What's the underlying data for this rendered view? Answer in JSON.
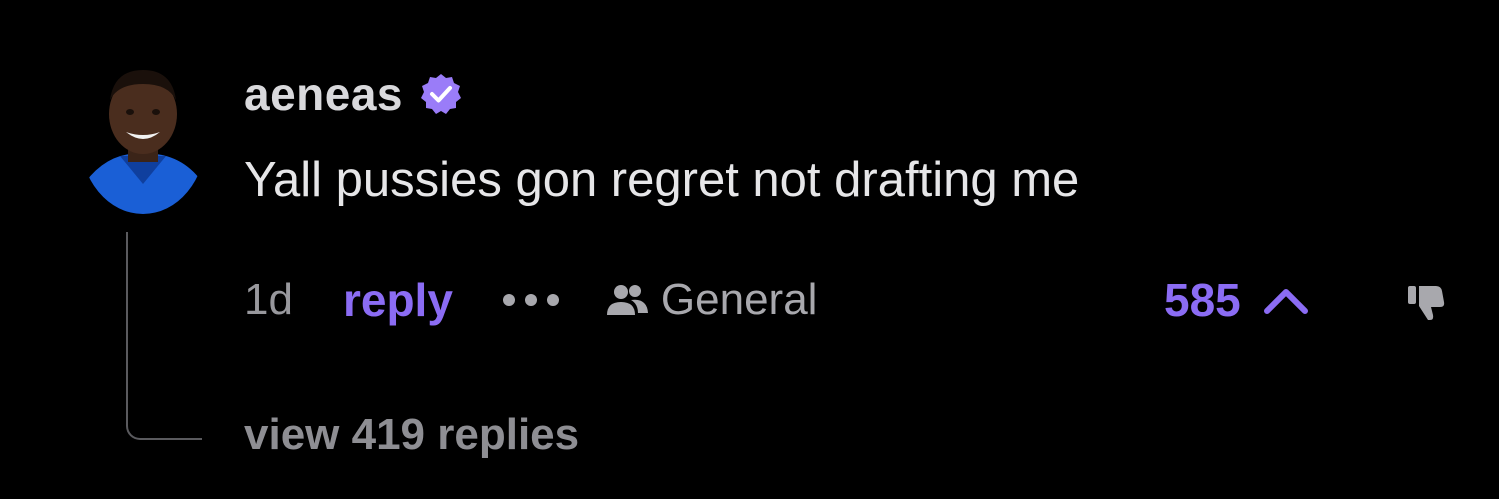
{
  "comment": {
    "username": "aeneas",
    "verified_icon": "verified-check-icon",
    "text": "Yall pussies gon regret not drafting me",
    "time_ago": "1d",
    "reply_label": "reply",
    "more_icon": "more-dots-icon",
    "channel_icon": "group-icon",
    "channel_label": "General",
    "vote_count": "585",
    "upvote_icon": "chevron-up-icon",
    "downvote_icon": "thumbs-down-icon",
    "view_replies_label": "view 419 replies"
  },
  "colors": {
    "background": "#000000",
    "accent": "#8b6cf4",
    "verified_badge": "#9a7cf8",
    "muted_text": "#98989d",
    "body_text": "#e6e6e8"
  }
}
